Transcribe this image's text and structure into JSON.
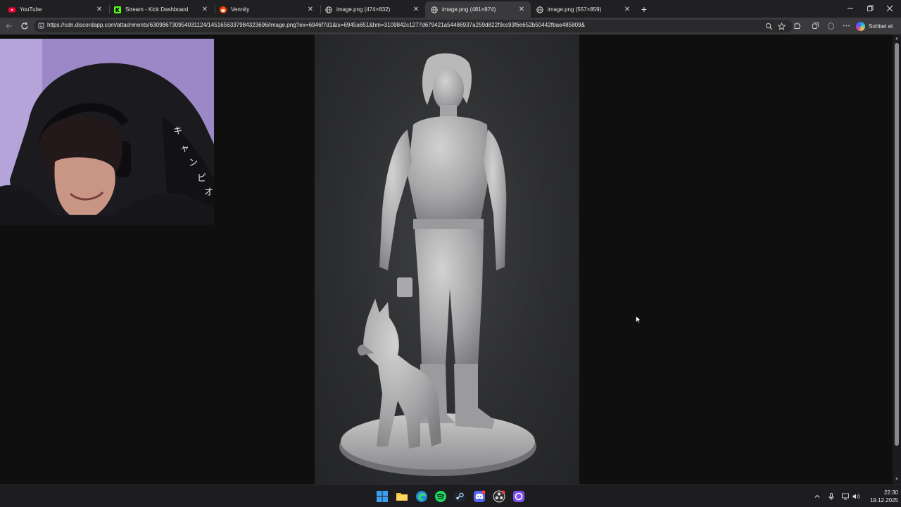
{
  "browser": {
    "tabs": [
      {
        "label": "YouTube",
        "icon": "youtube-icon",
        "active": false
      },
      {
        "label": "Stream - Kick Dashboard",
        "icon": "kick-icon",
        "active": false
      },
      {
        "label": "Vennity",
        "icon": "reddit-icon",
        "active": false
      },
      {
        "label": "image.png (474×832)",
        "icon": "globe-icon",
        "active": false
      },
      {
        "label": "image.png (481×874)",
        "icon": "globe-icon",
        "active": true
      },
      {
        "label": "image.png (557×859)",
        "icon": "globe-icon",
        "active": false
      }
    ],
    "tab_close_glyph": "✕",
    "new_tab_glyph": "+",
    "address": {
      "url": "https://cdn.discordapp.com/attachments/630986730954031124/1451656337984323696/image.png?ex=6946f7d1&is=6945a651&hm=3109842c1277d679421a54486937a259d822f9cc93f6e652b50442fbae485809&"
    },
    "copilot_label": "Sohbet et",
    "accent_colors": {
      "youtube": "#ff0033",
      "kick": "#53fc18",
      "reddit": "#ff4500"
    }
  },
  "taskbar": {
    "apps": [
      "windows-start-icon",
      "file-explorer-icon",
      "edge-icon",
      "spotify-icon",
      "steam-icon",
      "discord-icon",
      "obs-icon",
      "app-circle-icon"
    ],
    "clock": {
      "time": "22:30",
      "date": "19.12.2025"
    }
  }
}
